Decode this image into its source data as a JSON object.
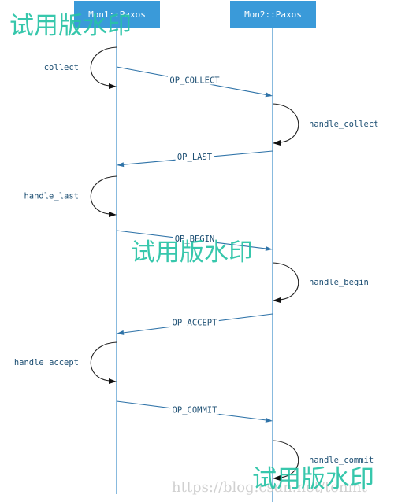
{
  "diagram": {
    "type": "sequence",
    "actors": [
      {
        "id": "mon1",
        "label": "Mon1::Paxos"
      },
      {
        "id": "mon2",
        "label": "Mon2::Paxos"
      }
    ],
    "steps": [
      {
        "kind": "self",
        "actor": "mon1",
        "label": "collect"
      },
      {
        "kind": "message",
        "from": "mon1",
        "to": "mon2",
        "label": "OP_COLLECT"
      },
      {
        "kind": "self",
        "actor": "mon2",
        "label": "handle_collect"
      },
      {
        "kind": "message",
        "from": "mon2",
        "to": "mon1",
        "label": "OP_LAST"
      },
      {
        "kind": "self",
        "actor": "mon1",
        "label": "handle_last"
      },
      {
        "kind": "message",
        "from": "mon1",
        "to": "mon2",
        "label": "OP_BEGIN"
      },
      {
        "kind": "self",
        "actor": "mon2",
        "label": "handle_begin"
      },
      {
        "kind": "message",
        "from": "mon2",
        "to": "mon1",
        "label": "OP_ACCEPT"
      },
      {
        "kind": "self",
        "actor": "mon1",
        "label": "handle_accept"
      },
      {
        "kind": "message",
        "from": "mon1",
        "to": "mon2",
        "label": "OP_COMMIT"
      },
      {
        "kind": "self",
        "actor": "mon2",
        "label": "handle_commit"
      }
    ],
    "colors": {
      "actor_box": "#3a9ad9",
      "lifeline": "#3a8dc9",
      "message": "#2f73a8",
      "label_text": "#1d4f73",
      "self_arrow": "#222222"
    }
  },
  "watermarks": {
    "trial_text": "试用版水印",
    "url_text": "https://blog.csdn.net/tenmt",
    "color": "#27c3a5"
  }
}
